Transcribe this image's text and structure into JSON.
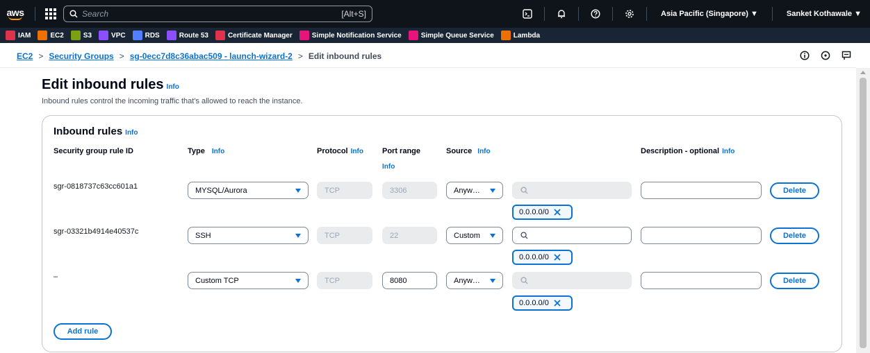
{
  "nav": {
    "logo_text": "aws",
    "search_placeholder": "Search",
    "search_shortcut": "[Alt+S]",
    "region": "Asia Pacific (Singapore) ▼",
    "user": "Sanket Kothawale ▼"
  },
  "favorites": [
    {
      "label": "IAM",
      "color": "#dd344c"
    },
    {
      "label": "EC2",
      "color": "#ed7100"
    },
    {
      "label": "S3",
      "color": "#7aa116"
    },
    {
      "label": "VPC",
      "color": "#8c4fff"
    },
    {
      "label": "RDS",
      "color": "#527fff"
    },
    {
      "label": "Route 53",
      "color": "#8c4fff"
    },
    {
      "label": "Certificate Manager",
      "color": "#dd344c"
    },
    {
      "label": "Simple Notification Service",
      "color": "#e7157b"
    },
    {
      "label": "Simple Queue Service",
      "color": "#e7157b"
    },
    {
      "label": "Lambda",
      "color": "#ed7100"
    }
  ],
  "breadcrumb": {
    "items": [
      "EC2",
      "Security Groups",
      "sg-0ecc7d8c36abac509 - launch-wizard-2"
    ],
    "current": "Edit inbound rules"
  },
  "page": {
    "title": "Edit inbound rules",
    "info": "Info",
    "description": "Inbound rules control the incoming traffic that's allowed to reach the instance."
  },
  "rules_panel": {
    "title": "Inbound rules",
    "info": "Info",
    "headers": {
      "rule_id": "Security group rule ID",
      "type": "Type",
      "protocol": "Protocol",
      "port_range": "Port range",
      "source": "Source",
      "description": "Description - optional"
    },
    "rules": [
      {
        "id": "sgr-0818737c63cc601a1",
        "type": "MYSQL/Aurora",
        "protocol": "TCP",
        "port": "3306",
        "source": "Anyw…",
        "cidr": "0.0.0.0/0",
        "delete": "Delete"
      },
      {
        "id": "sgr-03321b4914e40537c",
        "type": "SSH",
        "protocol": "TCP",
        "port": "22",
        "source": "Custom",
        "cidr": "0.0.0.0/0",
        "delete": "Delete"
      },
      {
        "id": "–",
        "type": "Custom TCP",
        "protocol": "TCP",
        "port": "8080",
        "source": "Anyw…",
        "cidr": "0.0.0.0/0",
        "delete": "Delete"
      }
    ],
    "add_rule": "Add rule"
  },
  "colors": {
    "accent": "#0972d3",
    "nav_bg": "#0f141a",
    "fav_bg": "#192534"
  }
}
